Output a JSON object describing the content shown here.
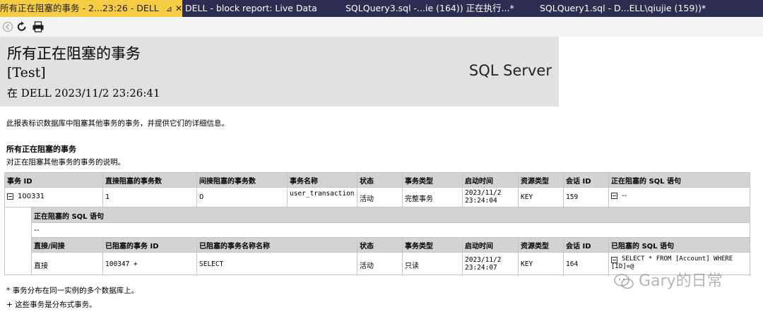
{
  "tabs": [
    {
      "label": "所有正在阻塞的事务 - 2...23:26 - DELL",
      "pin": "⊿",
      "close": "✕"
    },
    {
      "label": "DELL - block report: Live Data"
    },
    {
      "label": "SQLQuery3.sql -...ie (164)) 正在执行...*"
    },
    {
      "label": "SQLQuery1.sql - D...ELL\\qiujie (159))*"
    }
  ],
  "toolbar": {
    "icons": [
      "back-icon",
      "refresh-icon",
      "print-icon"
    ]
  },
  "report": {
    "title": "所有正在阻塞的事务",
    "database": "[Test]",
    "timestamp": "在 DELL 2023/11/2 23:26:41",
    "brand": "SQL Server",
    "description": "此报表标识数据库中阻塞其他事务的事务，并提供它们的详细信息。"
  },
  "section": {
    "title": "所有正在阻塞的事务",
    "subtitle": "对正在阻塞其他事务的事务的说明。"
  },
  "main_table": {
    "headers": [
      "事务 ID",
      "直接阻塞的事务数",
      "间接阻塞的事务数",
      "事务名称",
      "状态",
      "事务类型",
      "启动时间",
      "资源类型",
      "会话 ID",
      "正在阻塞的 SQL 语句"
    ],
    "row": {
      "id": "100331",
      "direct": "1",
      "indirect": "0",
      "name": "user_transaction",
      "status": "活动",
      "type": "完整事务",
      "start": "2023/11/2 23:24:04",
      "resource": "KEY",
      "session": "159",
      "sql": "--"
    }
  },
  "blocking_sql": {
    "header": "正在阻塞的 SQL 语句",
    "value": "--"
  },
  "sub_table": {
    "headers": [
      "直接/间接",
      "已阻塞的事务 ID",
      "已阻塞的事务名称名称",
      "状态",
      "事务类型",
      "启动时间",
      "资源类型",
      "会话 ID",
      "已阻塞的 SQL 语句"
    ],
    "row": {
      "kind": "直接",
      "id": "100347 +",
      "name": "SELECT",
      "status": "活动",
      "type": "只读",
      "start": "2023/11/2 23:24:07",
      "resource": "KEY",
      "session": "164",
      "sql": "SELECT * FROM [Account] WHERE [ID]=@"
    }
  },
  "footnotes": [
    "* 事务分布在同一实例的多个数据库上。",
    "+ 这些事务是分布式事务。"
  ],
  "watermark": "Gary的日常"
}
